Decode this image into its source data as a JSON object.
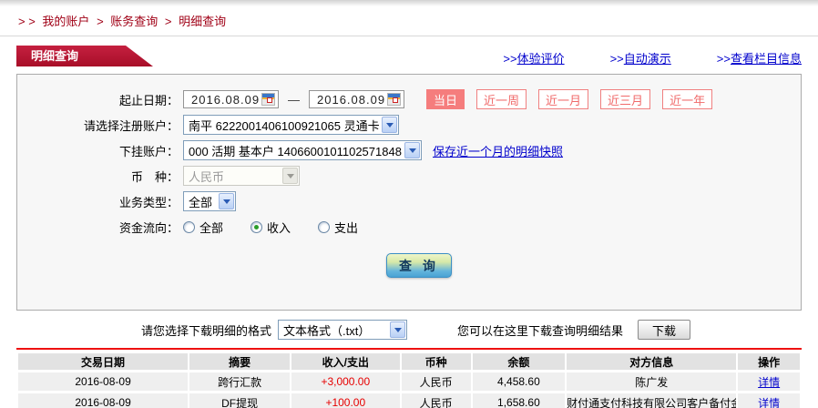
{
  "breadcrumb": {
    "prefix": "> >",
    "separator": ">",
    "items": [
      "我的账户",
      "账务查询",
      "明细查询"
    ]
  },
  "header": {
    "tab_label": "明细查询",
    "links": [
      {
        "prefix": ">>",
        "label": "体验评价"
      },
      {
        "prefix": ">>",
        "label": "自动演示"
      },
      {
        "prefix": ">>",
        "label": "查看栏目信息"
      }
    ]
  },
  "form": {
    "date_range": {
      "label": "起止日期：",
      "start": "2016.08.09",
      "end": "2016.08.09",
      "separator": "—"
    },
    "quick_buttons": [
      {
        "label": "当日",
        "active": true
      },
      {
        "label": "近一周",
        "active": false
      },
      {
        "label": "近一月",
        "active": false
      },
      {
        "label": "近三月",
        "active": false
      },
      {
        "label": "近一年",
        "active": false
      }
    ],
    "registered_account": {
      "label": "请选择注册账户：",
      "value": "南平 6222001406100921065 灵通卡"
    },
    "sub_account": {
      "label": "下挂账户：",
      "value": "000 活期 基本户 1406600101102571848",
      "snapshot_link": "保存近一个月的明细快照"
    },
    "currency": {
      "label": "币　种：",
      "value": "人民币",
      "disabled": true
    },
    "business_type": {
      "label": "业务类型：",
      "value": "全部"
    },
    "fund_flow": {
      "label": "资金流向：",
      "options": [
        {
          "label": "全部",
          "checked": false
        },
        {
          "label": "收入",
          "checked": true
        },
        {
          "label": "支出",
          "checked": false
        }
      ]
    },
    "query_button": "查 询"
  },
  "download": {
    "format_label": "请您选择下载明细的格式",
    "format_value": "文本格式（.txt）",
    "hint": "您可以在这里下载查询明细结果",
    "button": "下载"
  },
  "table": {
    "headers": [
      "交易日期",
      "摘要",
      "收入/支出",
      "币种",
      "余额",
      "对方信息",
      "操作"
    ],
    "rows": [
      {
        "date": "2016-08-09",
        "summary": "跨行汇款",
        "amount": "+3,000.00",
        "currency": "人民币",
        "balance": "4,458.60",
        "counterparty": "陈广发",
        "action": "详情"
      },
      {
        "date": "2016-08-09",
        "summary": "DF提现",
        "amount": "+100.00",
        "currency": "人民币",
        "balance": "1,658.60",
        "counterparty": "财付通支付科技有限公司客户备付金",
        "action": "详情"
      }
    ]
  },
  "icons": {
    "calendar": "calendar-icon",
    "dropdown": "chevron-down-icon",
    "radio": "radio-icon"
  },
  "colors": {
    "tab_red": "#b2122e",
    "breadcrumb_red": "#a00016",
    "button_salmon": "#f57d7d",
    "amount_red": "#e60000",
    "link_blue": "#0000cc"
  }
}
